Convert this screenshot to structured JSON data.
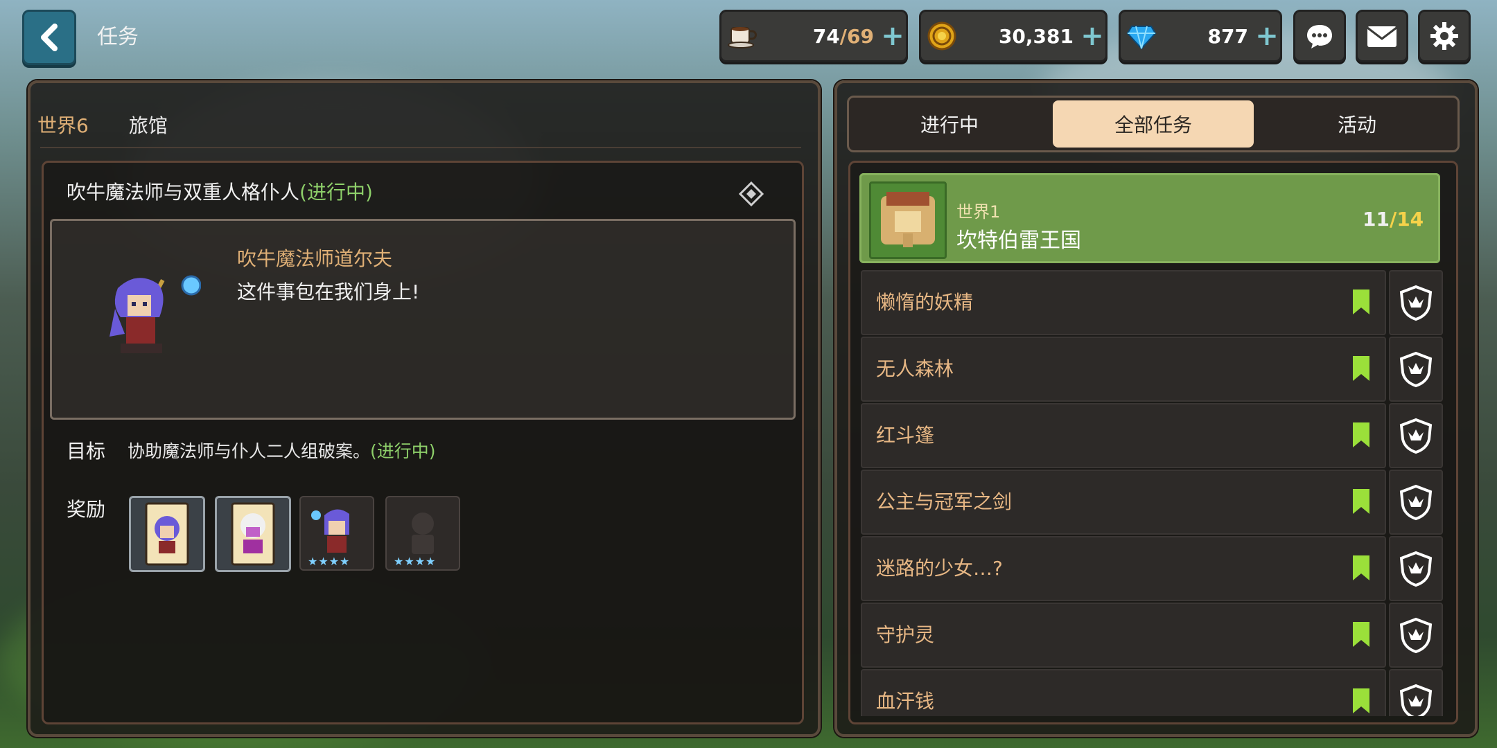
{
  "header": {
    "title": "任务",
    "resources": [
      {
        "name": "stamina",
        "value": "74",
        "max": "/69"
      },
      {
        "name": "gold",
        "value": "30,381"
      },
      {
        "name": "gems",
        "value": "877"
      }
    ],
    "plus": "+"
  },
  "left": {
    "tabs": [
      "世界6",
      "旅馆"
    ],
    "quest_title": "吹牛魔法师与双重人格仆人",
    "quest_status": "(进行中)",
    "npc_name": "吹牛魔法师道尔夫",
    "npc_line": "这件事包在我们身上!",
    "goal_label": "目标",
    "goal_text": "协助魔法师与仆人二人组破案。",
    "goal_status": "(进行中)",
    "reward_label": "奖励",
    "reward_stars": "★★★★"
  },
  "right": {
    "tabs": [
      "进行中",
      "全部任务",
      "活动"
    ],
    "active_tab": "全部任务",
    "world": {
      "sub": "世界1",
      "name": "坎特伯雷王国",
      "done": "11",
      "total": "/14"
    },
    "quests": [
      "懒惰的妖精",
      "无人森林",
      "红斗篷",
      "公主与冠军之剑",
      "迷路的少女…?",
      "守护灵",
      "血汗钱"
    ]
  },
  "colors": {
    "accent": "#e0b076",
    "status_green": "#8ed06a",
    "bookmark": "#9be03a",
    "tab_active": "#f5d7b3"
  }
}
